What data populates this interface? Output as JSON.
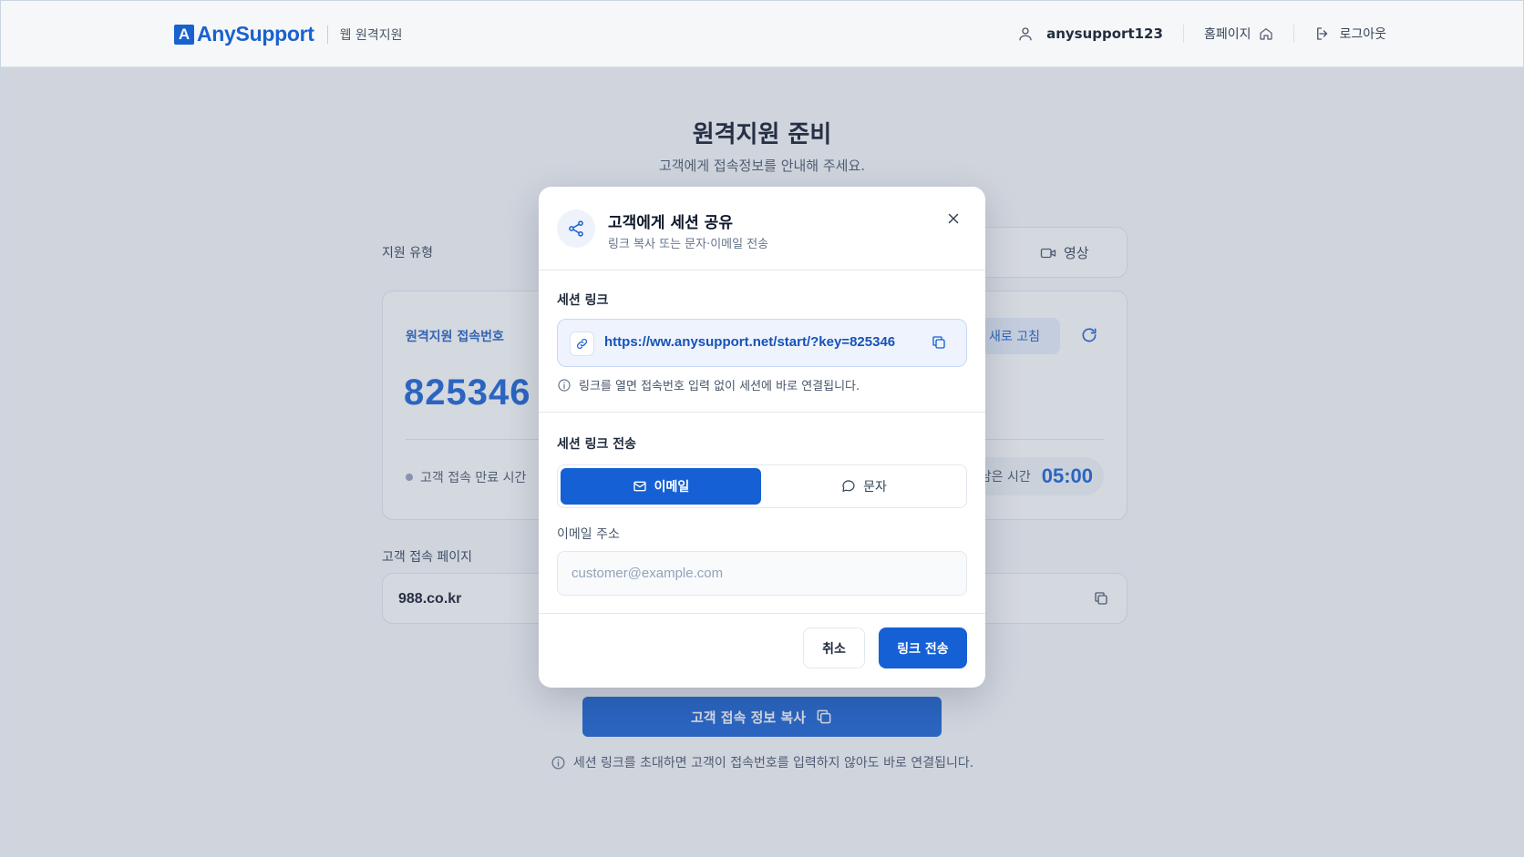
{
  "header": {
    "logo_mark": "A",
    "logo_text": "AnySupport",
    "subtitle": "웹 원격지원",
    "username": "anysupport123",
    "homepage_label": "홈페이지",
    "logout_label": "로그아웃"
  },
  "page": {
    "title": "원격지원 준비",
    "subtitle": "고객에게 접속정보를 안내해 주세요.",
    "support_type_label": "지원 유형",
    "video_label": "영상",
    "code_label": "원격지원 접속번호",
    "code_value": "825346",
    "refresh_label": "새로 고침",
    "expire_label": "고객 접속 만료 시간",
    "remaining_label": "남은 시간",
    "remaining_value": "05:00",
    "customer_page_label": "고객 접속 페이지",
    "customer_page_url": "988.co.kr",
    "copy_info_button": "고객 접속 정보 복사",
    "bottom_note": "세션 링크를 초대하면 고객이 접속번호를 입력하지 않아도 바로 연결됩니다."
  },
  "modal": {
    "title": "고객에게 세션 공유",
    "subtitle": "링크 복사 또는 문자·이메일 전송",
    "session_link_label": "세션 링크",
    "session_link_url": "https://ww.anysupport.net/start/?key=825346",
    "link_info": "링크를 열면 접속번호 입력 없이 세션에 바로 연결됩니다.",
    "send_label": "세션 링크 전송",
    "tab_email": "이메일",
    "tab_sms": "문자",
    "email_field_label": "이메일 주소",
    "email_placeholder": "customer@example.com",
    "email_value": "",
    "cancel_button": "취소",
    "send_button": "링크 전송"
  },
  "colors": {
    "accent": "#1560d4",
    "overlay": "#64748b"
  }
}
